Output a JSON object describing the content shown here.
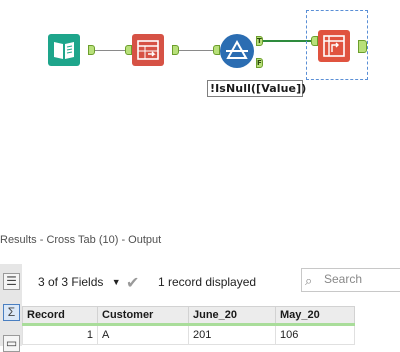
{
  "canvas": {
    "tools": [
      {
        "name": "input-data-tool",
        "icon": "book-icon"
      },
      {
        "name": "select-tool",
        "icon": "select-grid-icon"
      },
      {
        "name": "filter-tool",
        "icon": "filter-triangle-icon"
      },
      {
        "name": "cross-tab-tool",
        "icon": "cross-tab-icon"
      }
    ],
    "filter_anchors": {
      "true": "T",
      "false": "F"
    },
    "annotation": "!IsNull([Value])",
    "colors": {
      "input": "#1ea58b",
      "select": "#d65245",
      "filter": "#2b6db2",
      "crosstab": "#e0533f",
      "anchor": "#b8e07a"
    }
  },
  "results": {
    "title": "Results - Cross Tab (10) - Output",
    "fields_label": "3 of 3 Fields",
    "record_count": "1 record displayed",
    "search": {
      "placeholder": "Search"
    },
    "columns": [
      "Record",
      "Customer",
      "June_20",
      "May_20"
    ],
    "rows": [
      {
        "record": "1",
        "customer": "A",
        "june_20": "201",
        "may_20": "106"
      }
    ],
    "side_icons": [
      "list-icon",
      "sigma-icon",
      "message-icon"
    ]
  }
}
